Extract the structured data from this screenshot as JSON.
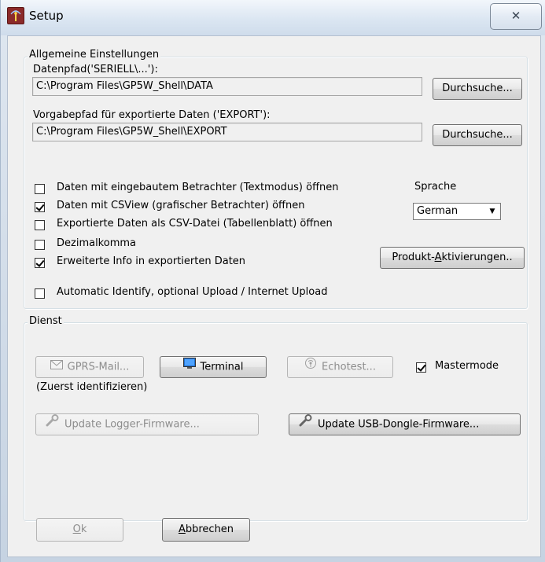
{
  "window": {
    "title": "Setup",
    "close_glyph": "✕"
  },
  "general": {
    "legend": "Allgemeine Einstellungen",
    "data_path_label": "Datenpfad('SERIELL\\...'):",
    "data_path_value": "C:\\Program Files\\GP5W_Shell\\DATA",
    "browse_label": "Durchsuche...",
    "export_path_label": "Vorgabepfad für exportierte Daten ('EXPORT'):",
    "export_path_value": "C:\\Program Files\\GP5W_Shell\\EXPORT",
    "options": [
      {
        "label": "Daten mit eingebautem Betrachter (Textmodus) öffnen",
        "checked": false
      },
      {
        "label": "Daten mit CSView (grafischer Betrachter) öffnen",
        "checked": true
      },
      {
        "label": "Exportierte Daten als CSV-Datei (Tabellenblatt) öffnen",
        "checked": false
      },
      {
        "label": "Dezimalkomma",
        "checked": false
      },
      {
        "label": "Erweiterte Info in exportierten Daten",
        "checked": true
      },
      {
        "label": "Automatic Identify, optional Upload / Internet Upload",
        "checked": false
      }
    ],
    "language_label": "Sprache",
    "language_value": "German",
    "activation_label_pre": "Produkt-",
    "activation_label_u": "A",
    "activation_label_post": "ktivierungen.."
  },
  "service": {
    "legend": "Dienst",
    "gprs_label": "GPRS-Mail...",
    "terminal_label": "Terminal",
    "echotest_label": "Echotest...",
    "mastermode_label": "Mastermode",
    "mastermode_checked": true,
    "identify_note": "(Zuerst identifizieren)",
    "update_logger_label": "Update Logger-Firmware...",
    "update_dongle_label": "Update USB-Dongle-Firmware..."
  },
  "footer": {
    "ok_u": "O",
    "ok_rest": "k",
    "cancel_u": "A",
    "cancel_rest": "bbrechen"
  },
  "icons": {
    "app": "antenna-icon",
    "mail": "envelope-icon",
    "terminal": "monitor-icon",
    "echotest": "signal-icon",
    "wrench": "wrench-icon"
  }
}
